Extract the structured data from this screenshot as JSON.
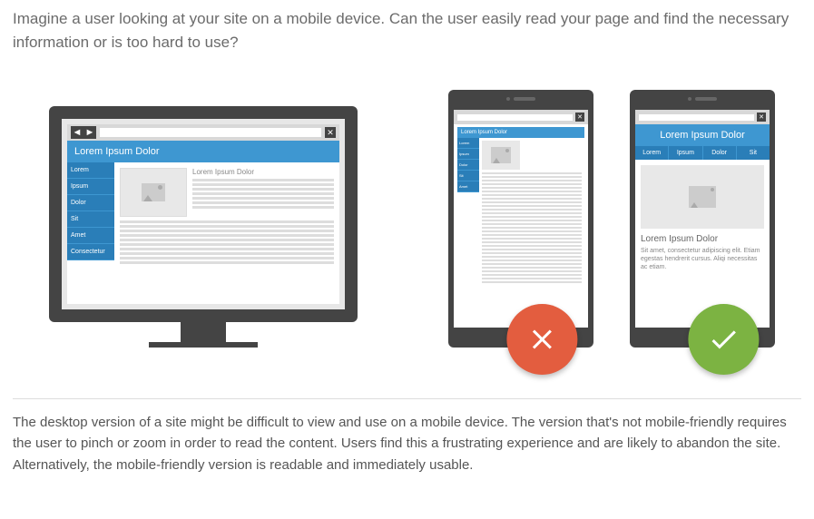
{
  "intro": "Imagine a user looking at your site on a mobile device. Can the user easily read your page and find the necessary information or is too hard to use?",
  "caption": "The desktop version of a site might be difficult to view and use on a mobile device. The version that's not mobile-friendly requires the user to pinch or zoom in order to read the content. Users find this a frustrating experience and are likely to abandon the site. Alternatively, the mobile-friendly version is readable and immediately usable.",
  "mock": {
    "header": "Lorem Ipsum Dolor",
    "sidebar": [
      "Lorem",
      "Ipsum",
      "Dolor",
      "Sit",
      "Amet",
      "Consectetur"
    ],
    "article_title": "Lorem Ipsum Dolor",
    "friendly_tabs": [
      "Lorem",
      "Ipsum",
      "Dolor",
      "Sit"
    ],
    "friendly_text": "Sit amet, consectetur adipiscing elit. Etiam egestas hendrerit cursus. Aliqi necessitas ac etiam."
  },
  "badges": {
    "fail_label": "not-mobile-friendly",
    "pass_label": "mobile-friendly"
  }
}
